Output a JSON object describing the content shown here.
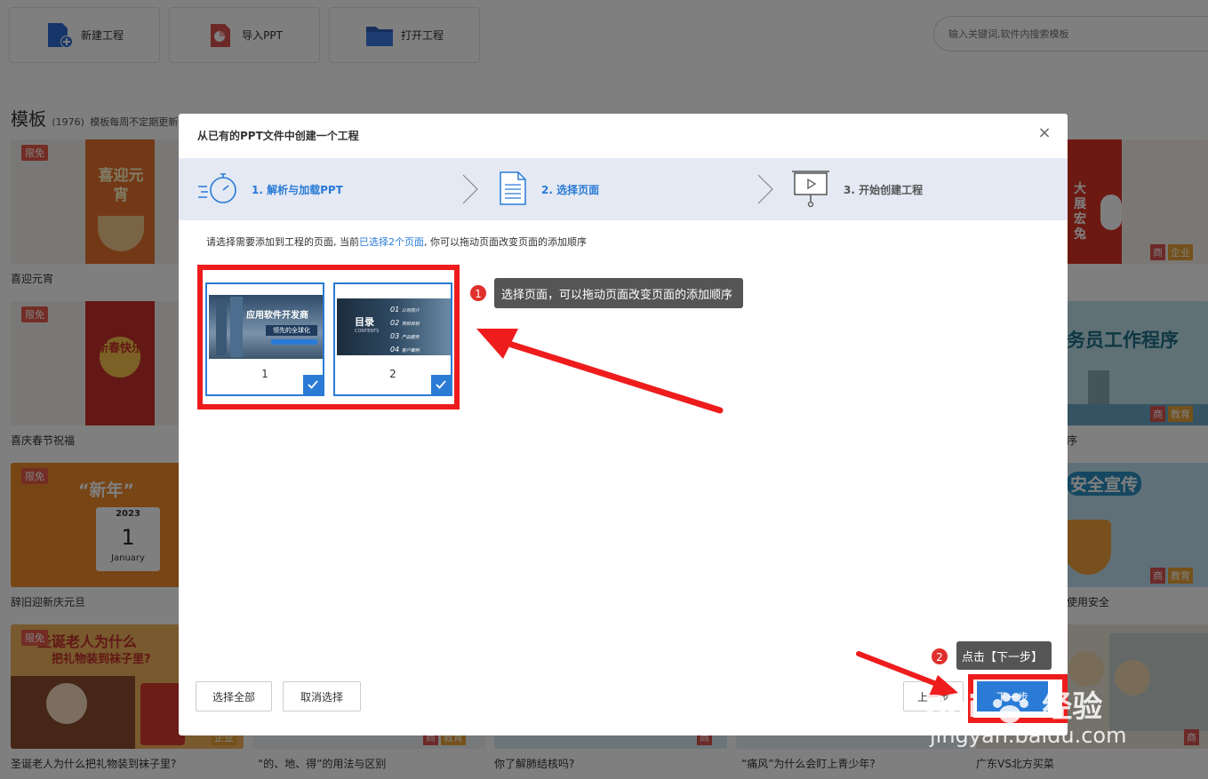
{
  "toolbar": {
    "new_project": "新建工程",
    "import_ppt": "导入PPT",
    "open_project": "打开工程",
    "search_placeholder": "输入关键词,软件内搜索模板"
  },
  "section": {
    "title": "模板",
    "count": "(1976)",
    "subtitle": "模板每周不定期更新"
  },
  "cards": {
    "free_badge": "限免",
    "tag_shang": "商",
    "tag_ent": "企业",
    "tag_edu": "教育",
    "c1": "喜迎元宵",
    "c1_art": "喜迎元宵",
    "c2": "喜庆春节祝福",
    "c2_art": "新春快乐",
    "c3": "辞旧迎新庆元旦",
    "c3_art": "“新年”",
    "c3_year": "2023",
    "c3_day": "1",
    "c3_month": "January",
    "c4": "圣诞老人为什么把礼物装到袜子里?",
    "c4_art_l1": "圣诞老人为什么",
    "c4_art_l2": "把礼物装到袜子里?",
    "c5": "“的、地、得”的用法与区别",
    "c6": "你了解肺结核吗?",
    "c7": "“痛风”为什么会盯上青少年?",
    "c8": "广东VS北方买菜",
    "r1_art": "大展宏兔",
    "r2_art": "务员工作程序",
    "r2_cap": "序",
    "r3_art": "安全宣传",
    "r3_cap": "使用安全"
  },
  "dialog": {
    "title": "从已有的PPT文件中创建一个工程",
    "close_glyph": "×",
    "steps": [
      {
        "label": "1. 解析与加载PPT"
      },
      {
        "label": "2. 选择页面"
      },
      {
        "label": "3. 开始创建工程"
      }
    ],
    "instruction_pre": "请选择需要添加到工程的页面, 当前",
    "instruction_hl": "已选择2个页面",
    "instruction_post": ", 你可以拖动页面改变页面的添加顺序",
    "pages": [
      {
        "num": "1",
        "heading": "应用软件开发商",
        "sub": "领先的全球化"
      },
      {
        "num": "2",
        "heading": "目录",
        "sub": "CONTENTS",
        "items": [
          "公司简介",
          "项目目标",
          "产品服务",
          "客户案例"
        ],
        "item_nums": [
          "01",
          "02",
          "03",
          "04"
        ]
      }
    ],
    "select_all": "选择全部",
    "deselect": "取消选择",
    "prev": "上一步",
    "next": "下一步"
  },
  "annotations": {
    "n1": "1",
    "callout1": "选择页面，可以拖动页面改变页面的添加顺序",
    "n2": "2",
    "callout2": "点击【下一步】"
  },
  "watermark": {
    "brand_en": "Bai",
    "brand_cn": "经验",
    "url": "jingyan.baidu.com"
  },
  "colors": {
    "accent": "#2a7bd5",
    "annotation_red": "#ee1c1c",
    "badge_red": "#e75b4b"
  }
}
